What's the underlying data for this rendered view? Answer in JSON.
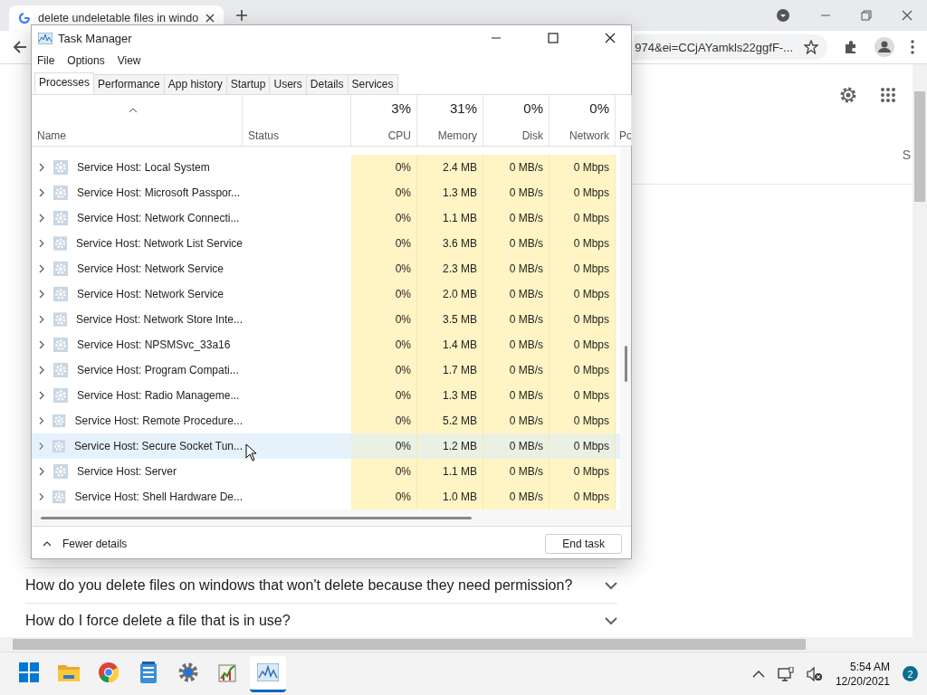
{
  "browser": {
    "tab_title": "delete undeletable files in windo",
    "address": "974&ei=CCjAYamkls22ggfF-...",
    "page_tab_fragment": "S",
    "faq": [
      {
        "question": "How do you delete files on windows that won't delete because they need permission?",
        "expanded": false
      },
      {
        "question": "How do I force delete a file that is in use?",
        "expanded": false
      }
    ]
  },
  "task_manager": {
    "title": "Task Manager",
    "menu": [
      "File",
      "Options",
      "View"
    ],
    "tabs": [
      {
        "label": "Processes",
        "selected": true
      },
      {
        "label": "Performance",
        "selected": false
      },
      {
        "label": "App history",
        "selected": false
      },
      {
        "label": "Startup",
        "selected": false
      },
      {
        "label": "Users",
        "selected": false
      },
      {
        "label": "Details",
        "selected": false
      },
      {
        "label": "Services",
        "selected": false
      }
    ],
    "columns": [
      {
        "label": "Name",
        "kind": "name"
      },
      {
        "label": "Status",
        "kind": "text"
      },
      {
        "label": "CPU",
        "percent": "3%",
        "kind": "metric"
      },
      {
        "label": "Memory",
        "percent": "31%",
        "kind": "metric"
      },
      {
        "label": "Disk",
        "percent": "0%",
        "kind": "metric"
      },
      {
        "label": "Network",
        "percent": "0%",
        "kind": "metric"
      },
      {
        "label": "Po",
        "kind": "cut"
      }
    ],
    "rows": [
      {
        "name": "Service Host: Local System",
        "cpu": "0%",
        "memory": "2.4 MB",
        "disk": "0 MB/s",
        "network": "0 Mbps",
        "selected": false
      },
      {
        "name": "Service Host: Microsoft Passpor...",
        "cpu": "0%",
        "memory": "1.3 MB",
        "disk": "0 MB/s",
        "network": "0 Mbps",
        "selected": false
      },
      {
        "name": "Service Host: Network Connecti...",
        "cpu": "0%",
        "memory": "1.1 MB",
        "disk": "0 MB/s",
        "network": "0 Mbps",
        "selected": false
      },
      {
        "name": "Service Host: Network List Service",
        "cpu": "0%",
        "memory": "3.6 MB",
        "disk": "0 MB/s",
        "network": "0 Mbps",
        "selected": false
      },
      {
        "name": "Service Host: Network Service",
        "cpu": "0%",
        "memory": "2.3 MB",
        "disk": "0 MB/s",
        "network": "0 Mbps",
        "selected": false
      },
      {
        "name": "Service Host: Network Service",
        "cpu": "0%",
        "memory": "2.0 MB",
        "disk": "0 MB/s",
        "network": "0 Mbps",
        "selected": false
      },
      {
        "name": "Service Host: Network Store Inte...",
        "cpu": "0%",
        "memory": "3.5 MB",
        "disk": "0 MB/s",
        "network": "0 Mbps",
        "selected": false
      },
      {
        "name": "Service Host: NPSMSvc_33a16",
        "cpu": "0%",
        "memory": "1.4 MB",
        "disk": "0 MB/s",
        "network": "0 Mbps",
        "selected": false
      },
      {
        "name": "Service Host: Program Compati...",
        "cpu": "0%",
        "memory": "1.7 MB",
        "disk": "0 MB/s",
        "network": "0 Mbps",
        "selected": false
      },
      {
        "name": "Service Host: Radio Manageme...",
        "cpu": "0%",
        "memory": "1.3 MB",
        "disk": "0 MB/s",
        "network": "0 Mbps",
        "selected": false
      },
      {
        "name": "Service Host: Remote Procedure...",
        "cpu": "0%",
        "memory": "5.2 MB",
        "disk": "0 MB/s",
        "network": "0 Mbps",
        "selected": false
      },
      {
        "name": "Service Host: Secure Socket Tun...",
        "cpu": "0%",
        "memory": "1.2 MB",
        "disk": "0 MB/s",
        "network": "0 Mbps",
        "selected": true
      },
      {
        "name": "Service Host: Server",
        "cpu": "0%",
        "memory": "1.1 MB",
        "disk": "0 MB/s",
        "network": "0 Mbps",
        "selected": false
      },
      {
        "name": "Service Host: Shell Hardware De...",
        "cpu": "0%",
        "memory": "1.0 MB",
        "disk": "0 MB/s",
        "network": "0 Mbps",
        "selected": false
      }
    ],
    "fewer_details": "Fewer details",
    "end_task": "End task"
  },
  "taskbar": {
    "apps": [
      {
        "kind": "start",
        "active": false
      },
      {
        "kind": "explorer",
        "active": false
      },
      {
        "kind": "chrome",
        "active": false
      },
      {
        "kind": "notepad",
        "active": false
      },
      {
        "kind": "settings",
        "active": false
      },
      {
        "kind": "chart",
        "active": false
      },
      {
        "kind": "taskmgr",
        "active": true
      }
    ],
    "time": "5:54 AM",
    "date": "12/20/2021",
    "notifications": "2"
  }
}
